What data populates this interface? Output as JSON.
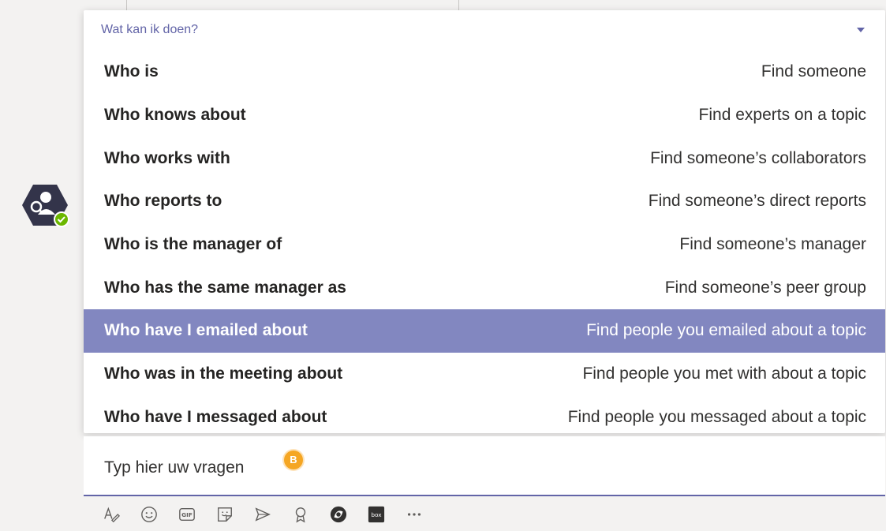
{
  "popup": {
    "title": "Wat kan ik doen?",
    "rows": [
      {
        "command": "Who is",
        "description": "Find someone"
      },
      {
        "command": "Who knows about",
        "description": "Find experts on a topic"
      },
      {
        "command": "Who works with",
        "description": "Find someone’s collaborators"
      },
      {
        "command": "Who reports to",
        "description": "Find someone’s direct reports"
      },
      {
        "command": "Who is the manager of",
        "description": "Find someone’s manager"
      },
      {
        "command": "Who has the same manager as",
        "description": "Find someone’s peer group"
      },
      {
        "command": "Who have I emailed about",
        "description": "Find people you emailed about a topic"
      },
      {
        "command": "Who was in the meeting about",
        "description": "Find people you met with about a topic"
      },
      {
        "command": "Who have I messaged about",
        "description": "Find people you messaged about a topic"
      }
    ],
    "selected_index": 6
  },
  "compose": {
    "text": "Typ hier uw vragen",
    "badge": "B"
  },
  "toolbar": {
    "icons": [
      "format-icon",
      "emoji-icon",
      "gif-icon",
      "sticker-icon",
      "meet-icon",
      "praise-icon",
      "app-icon",
      "box-icon",
      "more-icon"
    ],
    "box_label": "box"
  },
  "colors": {
    "accent": "#6264a7",
    "selected_row": "#8287c0",
    "badge": "#f5a623",
    "avatar": "#33344a"
  }
}
